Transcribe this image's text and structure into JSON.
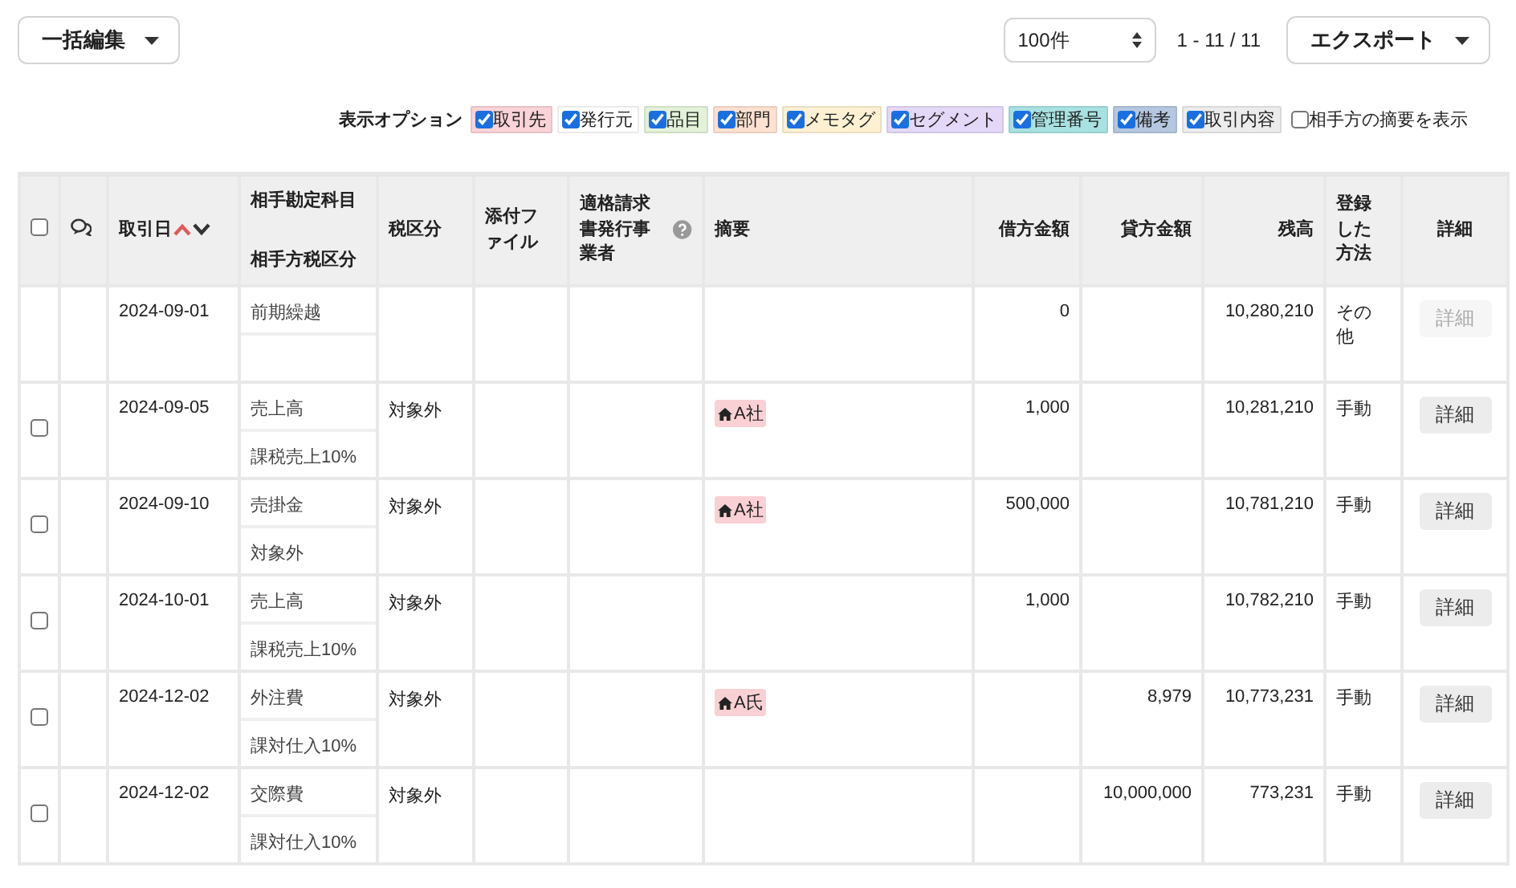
{
  "toolbar": {
    "bulk_edit_button": "一括編集",
    "per_page": "100件",
    "range": "1 - 11 / 11",
    "export_button": "エクスポート"
  },
  "display_options": {
    "label": "表示オプション",
    "options": [
      {
        "label": "取引先",
        "checked": true,
        "color": "#f9d3d7"
      },
      {
        "label": "発行元",
        "checked": true,
        "color": "#ffffff"
      },
      {
        "label": "品目",
        "checked": true,
        "color": "#e3f1d9"
      },
      {
        "label": "部門",
        "checked": true,
        "color": "#fde1d0"
      },
      {
        "label": "メモタグ",
        "checked": true,
        "color": "#fdf0d3"
      },
      {
        "label": "セグメント",
        "checked": true,
        "color": "#e4d8f8"
      },
      {
        "label": "管理番号",
        "checked": true,
        "color": "#a8e1e1"
      },
      {
        "label": "備考",
        "checked": true,
        "color": "#b5c7e0"
      },
      {
        "label": "取引内容",
        "checked": true,
        "color": "#ececec"
      },
      {
        "label": "相手方の摘要を表示",
        "checked": false
      }
    ]
  },
  "table": {
    "select_all": {
      "checked": false
    },
    "columns": {
      "date": "取引日",
      "account": "相手勘定科目",
      "partner_tax": "相手方税区分",
      "tax": "税区分",
      "attachment": "添付ファイル",
      "invoice_issuer": "適格請求書発行事業者",
      "memo": "摘要",
      "debit": "借方金額",
      "credit": "貸方金額",
      "balance": "残高",
      "method": "登録した方法",
      "detail": "詳細"
    },
    "rows": [
      {
        "date": "2024-09-01",
        "account": "前期繰越",
        "debit": "0",
        "balance": "10,280,210",
        "method": "その他",
        "detail": {
          "label": "詳細",
          "disabled": true
        }
      },
      {
        "checked": false,
        "date": "2024-09-05",
        "account": "売上高",
        "partner_tax": "課税売上10%",
        "tax": "対象外",
        "tag": {
          "text": "A社",
          "color": "#f9d0d3"
        },
        "debit": "1,000",
        "balance": "10,281,210",
        "method": "手動",
        "detail": {
          "label": "詳細",
          "disabled": false
        }
      },
      {
        "checked": false,
        "date": "2024-09-10",
        "account": "売掛金",
        "partner_tax": "対象外",
        "tax": "対象外",
        "tag": {
          "text": "A社",
          "color": "#f9d0d3"
        },
        "debit": "500,000",
        "balance": "10,781,210",
        "method": "手動",
        "detail": {
          "label": "詳細",
          "disabled": false
        }
      },
      {
        "checked": false,
        "date": "2024-10-01",
        "account": "売上高",
        "partner_tax": "課税売上10%",
        "tax": "対象外",
        "debit": "1,000",
        "balance": "10,782,210",
        "method": "手動",
        "detail": {
          "label": "詳細",
          "disabled": false
        }
      },
      {
        "checked": false,
        "date": "2024-12-02",
        "account": "外注費",
        "partner_tax": "課対仕入10%",
        "tax": "対象外",
        "tag": {
          "text": "A氏",
          "color": "#f9d0d3"
        },
        "credit": "8,979",
        "balance": "10,773,231",
        "method": "手動",
        "detail": {
          "label": "詳細",
          "disabled": false
        }
      },
      {
        "checked": false,
        "date": "2024-12-02",
        "account": "交際費",
        "partner_tax": "課対仕入10%",
        "tax": "対象外",
        "credit": "10,000,000",
        "balance": "773,231",
        "method": "手動",
        "detail": {
          "label": "詳細",
          "disabled": false
        }
      }
    ]
  }
}
